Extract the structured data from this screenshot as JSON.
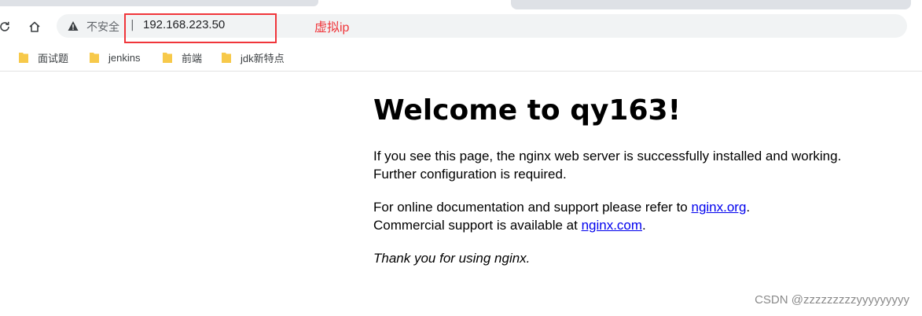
{
  "browser": {
    "security_label": "不安全",
    "separator": "|",
    "url": "192.168.223.50"
  },
  "annotation": {
    "label": "虚拟ip",
    "color": "#f0353a"
  },
  "bookmarks": [
    {
      "label": "面试题",
      "icon": "folder-icon"
    },
    {
      "label": "jenkins",
      "icon": "folder-icon"
    },
    {
      "label": "前端",
      "icon": "folder-icon"
    },
    {
      "label": "jdk新特点",
      "icon": "folder-icon"
    }
  ],
  "page": {
    "title": "Welcome to qy163!",
    "para1": "If you see this page, the nginx web server is successfully installed and working. Further configuration is required.",
    "para2_prefix": "For online documentation and support please refer to ",
    "link1": "nginx.org",
    "para2_mid_end": ".",
    "para2_line2_prefix": "Commercial support is available at ",
    "link2": "nginx.com",
    "para2_line2_end": ".",
    "thanks": "Thank you for using nginx."
  },
  "watermark": "CSDN @zzzzzzzzzyyyyyyyyy",
  "colors": {
    "folder": "#f7c94a",
    "link": "#0000ee",
    "annotation": "#f0353a"
  }
}
